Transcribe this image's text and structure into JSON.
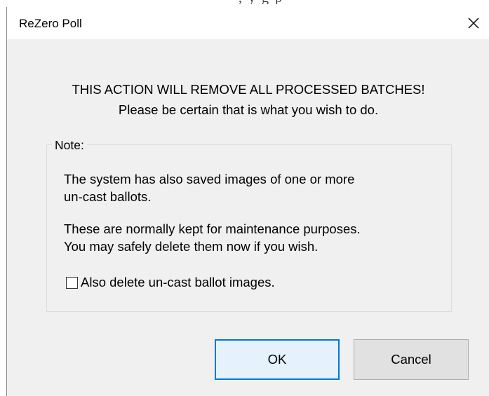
{
  "window": {
    "title": "ReZero Poll"
  },
  "message": {
    "line1": "THIS ACTION WILL REMOVE ALL PROCESSED BATCHES!",
    "line2": "Please be certain that is what you wish to do."
  },
  "note": {
    "legend": "Note:",
    "paragraph1_line1": "The system has also saved images of one or more",
    "paragraph1_line2": "un-cast ballots.",
    "paragraph2_line1": "These are normally kept for maintenance purposes.",
    "paragraph2_line2": "You may safely delete them now if you wish.",
    "checkbox_label": "Also delete un-cast ballot images.",
    "checkbox_checked": false
  },
  "buttons": {
    "ok_label": "OK",
    "cancel_label": "Cancel"
  },
  "icons": {
    "close": "close-icon"
  },
  "colors": {
    "dialog_bg": "#f0f0f0",
    "titlebar_bg": "#ffffff",
    "ok_border": "#0078d7",
    "ok_bg": "#e5f1fb",
    "cancel_bg": "#e1e1e1",
    "cancel_border": "#adadad"
  }
}
